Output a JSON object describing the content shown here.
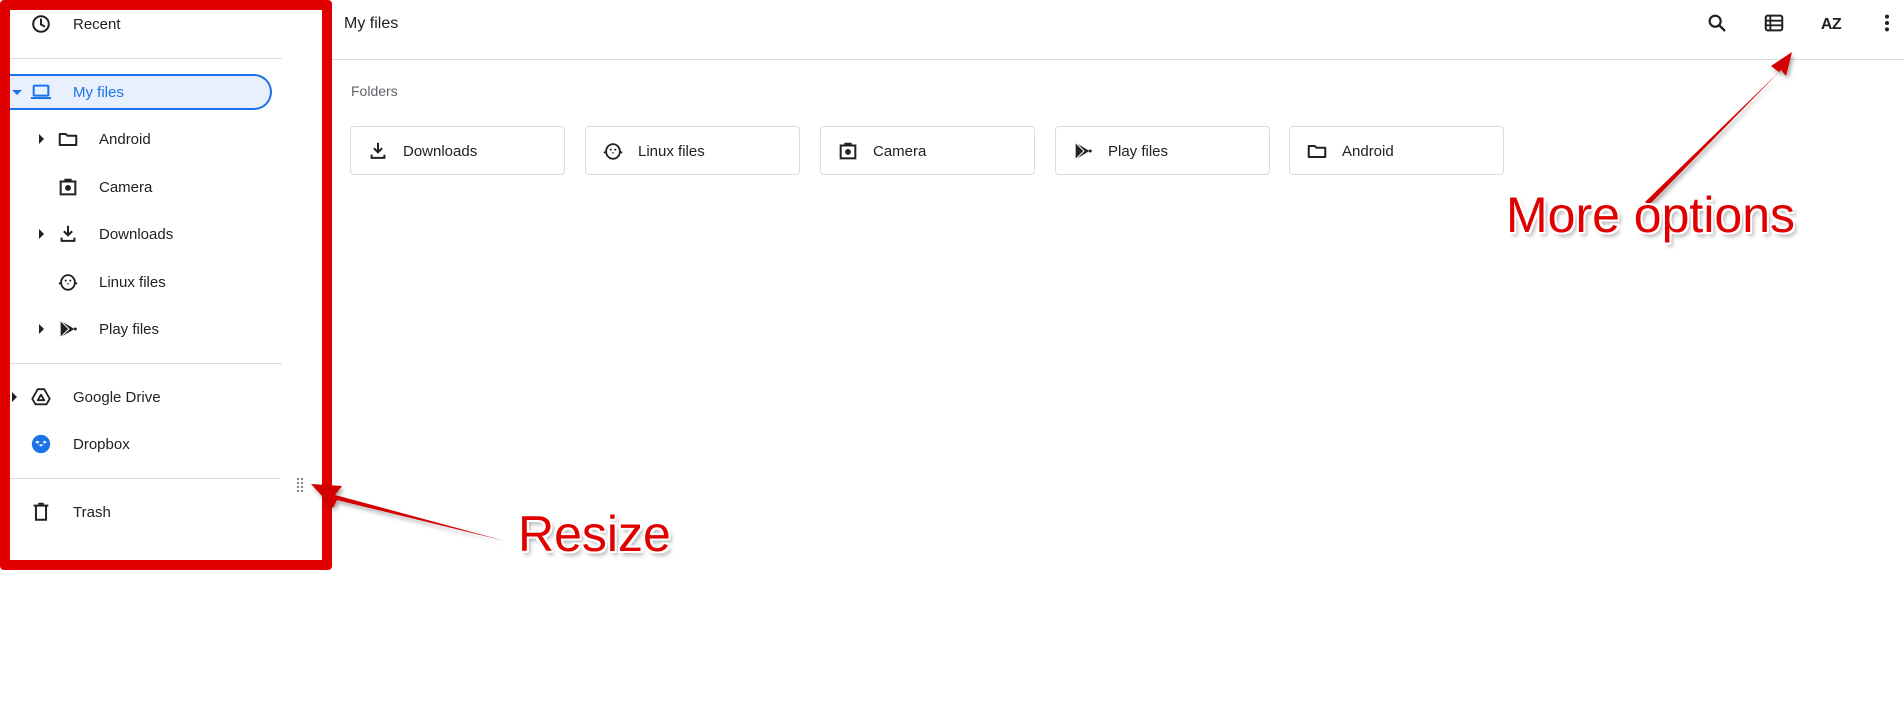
{
  "sidebar": {
    "items": [
      {
        "label": "Recent",
        "icon": "clock-icon"
      },
      {
        "label": "My files",
        "icon": "laptop-icon",
        "selected": true,
        "expanded": true
      },
      {
        "label": "Android",
        "icon": "folder-icon",
        "expandable": true
      },
      {
        "label": "Camera",
        "icon": "camera-icon"
      },
      {
        "label": "Downloads",
        "icon": "download-icon",
        "expandable": true
      },
      {
        "label": "Linux files",
        "icon": "penguin-icon"
      },
      {
        "label": "Play files",
        "icon": "play-store-icon",
        "expandable": true
      },
      {
        "label": "Google Drive",
        "icon": "google-drive-icon",
        "expandable": true
      },
      {
        "label": "Dropbox",
        "icon": "dropbox-icon"
      },
      {
        "label": "Trash",
        "icon": "trash-icon"
      }
    ]
  },
  "header": {
    "title": "My files",
    "tools": [
      {
        "name": "search",
        "icon": "search-icon"
      },
      {
        "name": "switch-view",
        "icon": "list-view-icon"
      },
      {
        "name": "sort",
        "icon": "sort-az-icon",
        "label": "AZ"
      },
      {
        "name": "more-options",
        "icon": "more-vert-icon"
      }
    ]
  },
  "main": {
    "section_label": "Folders",
    "folders": [
      {
        "label": "Downloads",
        "icon": "download-icon"
      },
      {
        "label": "Linux files",
        "icon": "penguin-icon"
      },
      {
        "label": "Camera",
        "icon": "camera-icon"
      },
      {
        "label": "Play files",
        "icon": "play-store-icon"
      },
      {
        "label": "Android",
        "icon": "folder-icon"
      }
    ]
  },
  "annotations": {
    "resize": "Resize",
    "more_options": "More options",
    "color": "#e00000"
  },
  "colors": {
    "accent": "#1a73e8",
    "selected_bg": "#e8f0fe",
    "divider": "#dadce0",
    "dropbox": "#1a73e8"
  }
}
